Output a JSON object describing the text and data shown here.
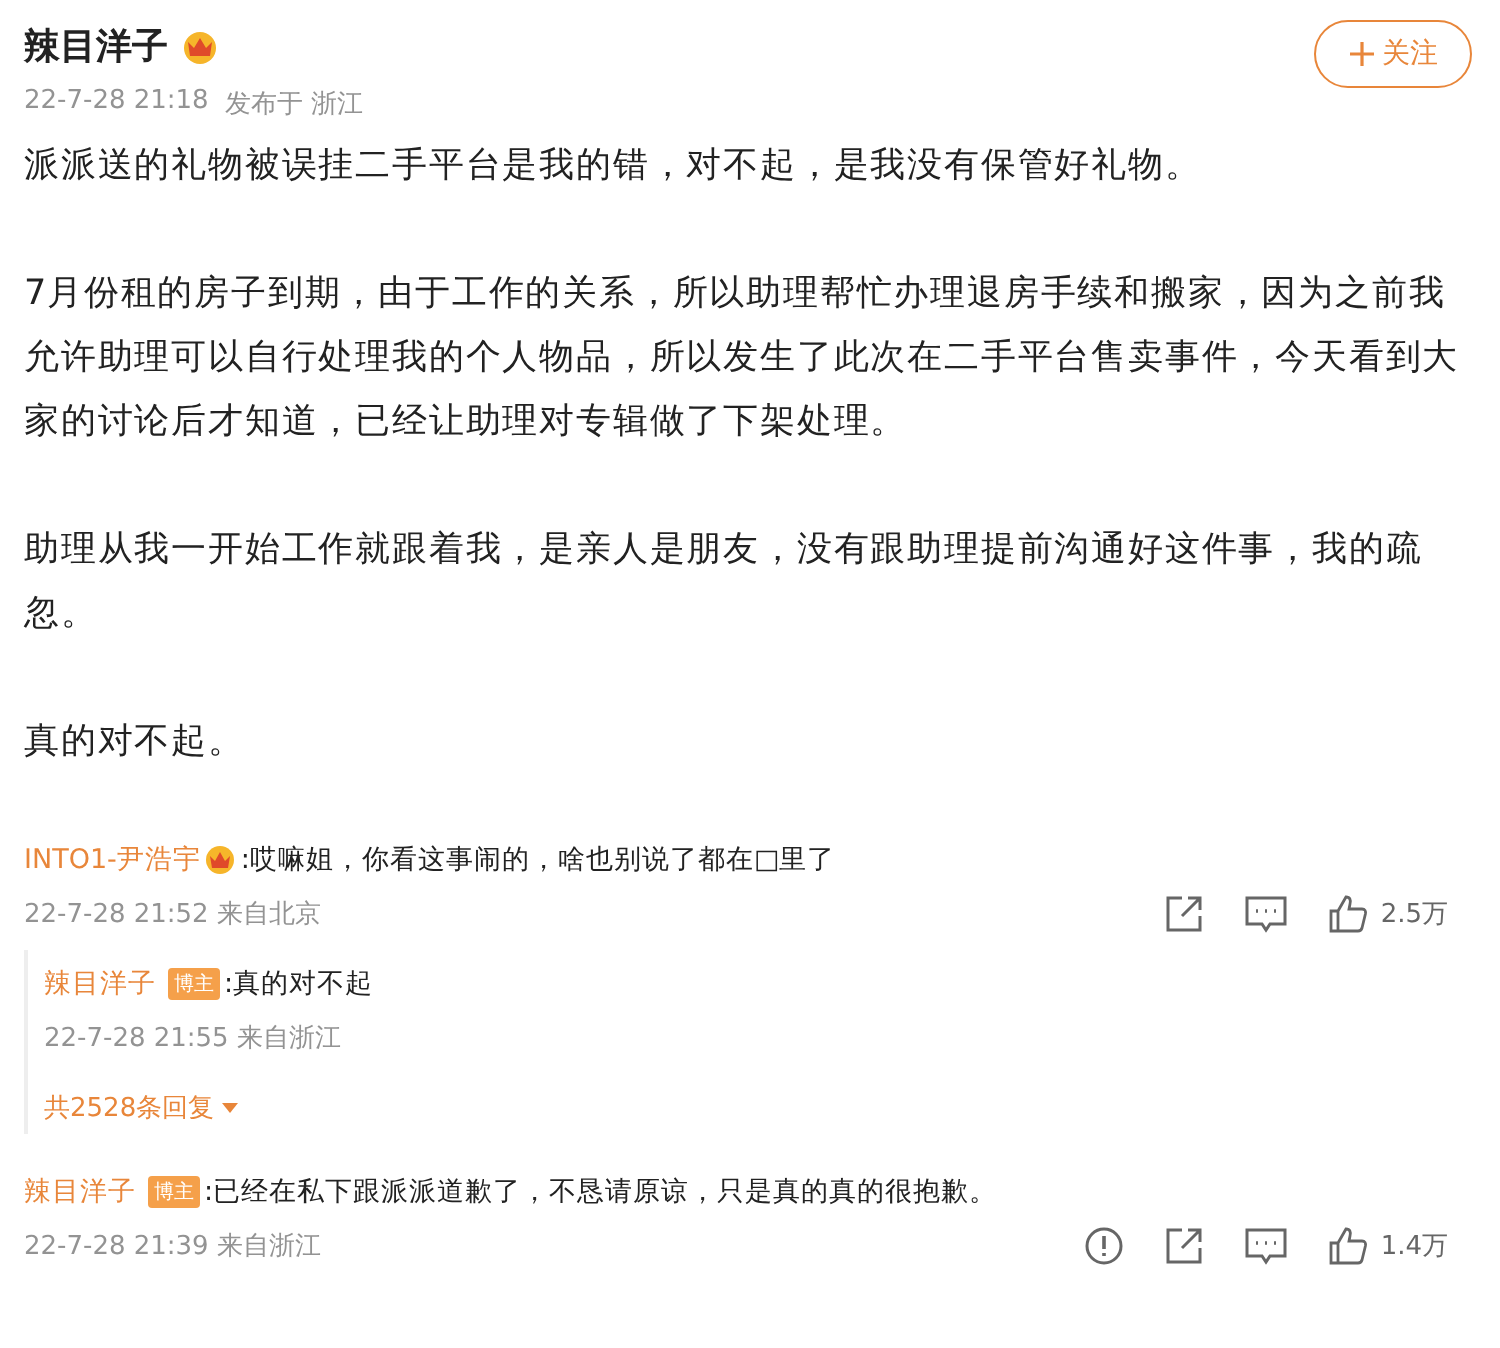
{
  "post": {
    "author": "辣目洋子",
    "time": "22-7-28 21:18",
    "location": "发布于 浙江",
    "follow_button": "关注",
    "paragraphs": [
      "派派送的礼物被误挂二手平台是我的错，对不起，是我没有保管好礼物。",
      "7月份租的房子到期，由于工作的关系，所以助理帮忙办理退房手续和搬家，因为之前我允许助理可以自行处理我的个人物品，所以发生了此次在二手平台售卖事件，今天看到大家的讨论后才知道，已经让助理对专辑做了下架处理。",
      "助理从我一开始工作就跟着我，是亲人是朋友，没有跟助理提前沟通好这件事，我的疏忽。",
      "真的对不起。"
    ]
  },
  "comments": [
    {
      "author": "INTO1-尹浩宇",
      "text": ":哎嘛姐，你看这事闹的，啥也别说了都在□里了",
      "time": "22-7-28 21:52",
      "location": "来自北京",
      "report": false,
      "likes": "2.5万",
      "replies": [
        {
          "author": "辣目洋子",
          "badge": "博主",
          "text": ":真的对不起",
          "time": "22-7-28 21:55",
          "location": "来自浙江"
        }
      ],
      "reply_count": "共2528条回复"
    },
    {
      "author": "辣目洋子",
      "badge": "博主",
      "text": ":已经在私下跟派派道歉了，不恳请原谅，只是真的真的很抱歉。",
      "time": "22-7-28 21:39",
      "location": "来自浙江",
      "report": true,
      "likes": "1.4万"
    }
  ]
}
